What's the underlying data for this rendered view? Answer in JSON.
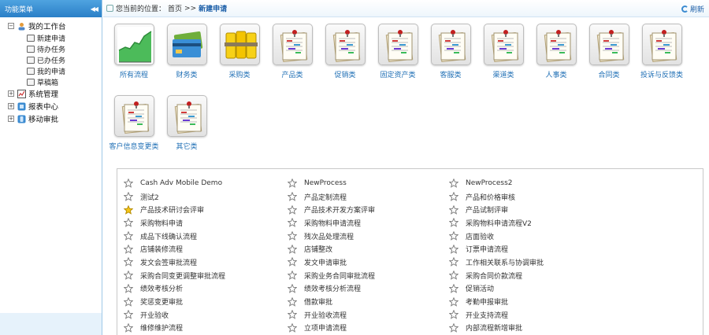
{
  "sidebar": {
    "title": "功能菜单",
    "collapse_icon": "double-chevron-left-icon",
    "tree": [
      {
        "label": "我的工作台",
        "icon": "user-icon",
        "expanded": true,
        "children": [
          "新建申请",
          "待办任务",
          "已办任务",
          "我的申请",
          "草稿箱"
        ]
      },
      {
        "label": "系统管理",
        "icon": "chart-icon",
        "expanded": false
      },
      {
        "label": "报表中心",
        "icon": "report-icon",
        "expanded": false
      },
      {
        "label": "移动审批",
        "icon": "mobile-icon",
        "expanded": false
      }
    ]
  },
  "topbar": {
    "location_label": "您当前的位置：",
    "home": "首页",
    "separator": ">>",
    "current": "新建申请",
    "refresh": "刷新"
  },
  "categories": [
    {
      "label": "所有流程",
      "icon": "growth-chart-icon"
    },
    {
      "label": "财务类",
      "icon": "credit-card-icon"
    },
    {
      "label": "采购类",
      "icon": "gold-bars-icon"
    },
    {
      "label": "产品类",
      "icon": "clipboard-doc-icon"
    },
    {
      "label": "促销类",
      "icon": "clipboard-doc-icon"
    },
    {
      "label": "固定资产类",
      "icon": "clipboard-doc-icon"
    },
    {
      "label": "客服类",
      "icon": "clipboard-doc-icon"
    },
    {
      "label": "渠道类",
      "icon": "clipboard-doc-icon"
    },
    {
      "label": "人事类",
      "icon": "clipboard-doc-icon"
    },
    {
      "label": "合同类",
      "icon": "clipboard-doc-icon"
    },
    {
      "label": "投诉与反馈类",
      "icon": "clipboard-doc-icon"
    },
    {
      "label": "客户信息变更类",
      "icon": "clipboard-doc-icon"
    },
    {
      "label": "其它类",
      "icon": "clipboard-doc-icon"
    }
  ],
  "processes": {
    "col1": [
      "Cash Adv Mobile Demo",
      "测试2",
      "产品技术研讨会评审",
      "采购物料申请",
      "成品下线确认流程",
      "店铺装修流程",
      "发文会签审批流程",
      "采购合同变更调整审批流程",
      "绩效考核分析",
      "奖惩变更审批",
      "开业验收",
      "维修维护流程"
    ],
    "col2": [
      "NewProcess",
      "产品定制流程",
      "产品技术开发方案评审",
      "采购物料申请流程",
      "残次品处理流程",
      "店铺整改",
      "发文申请审批",
      "采购业务合同审批流程",
      "绩效考核分析流程",
      "借款审批",
      "开业验收流程",
      "立项申请流程"
    ],
    "col3": [
      "NewProcess2",
      "产品和价格审核",
      "产品试制评审",
      "采购物料申请流程V2",
      "店面验收",
      "订票申请流程",
      "工作相关联系与协调审批",
      "采购合同价款流程",
      "促销活动",
      "考勤申报审批",
      "开业支持流程",
      "内部流程新增审批"
    ],
    "starred": [
      "产品技术研讨会评审"
    ]
  },
  "colors": {
    "header_bg": "#2a7fc7",
    "link_blue": "#1f6fb5",
    "star_active": "#f5c518"
  }
}
